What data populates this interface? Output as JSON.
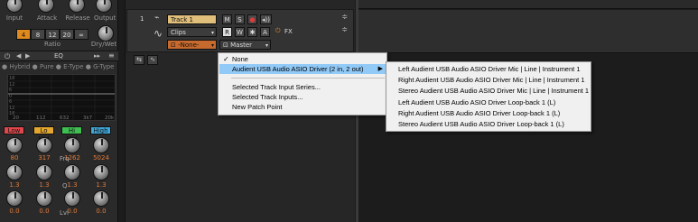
{
  "strip": {
    "knob_labels": [
      "Input",
      "Attack",
      "Release",
      "Output"
    ],
    "ratio_values": [
      "4",
      "8",
      "12",
      "20",
      "∞"
    ],
    "ratio_label": "Ratio",
    "drywet_label": "Dry/Wet",
    "eq_label": "EQ",
    "eq_types": "● Hybrid ● Pure ● E-Type ● G-Type",
    "eq_freq_ticks": [
      "20",
      "112",
      "632",
      "3k7",
      "20k"
    ],
    "eq_gain_ticks": [
      "18",
      "12",
      "6",
      "0",
      "6",
      "12",
      "18"
    ],
    "bands": [
      {
        "label": "Low",
        "color": "#e0474c"
      },
      {
        "label": "Lo Mid",
        "color": "#e3a72f"
      },
      {
        "label": "Hi Mid",
        "color": "#3fbf52"
      },
      {
        "label": "High",
        "color": "#3fa6d8"
      }
    ],
    "freq_values": [
      "80",
      "317",
      "1262",
      "5024"
    ],
    "freq_label": "Frq",
    "q_values": [
      "1.3",
      "1.3",
      "1.3",
      "1.3"
    ],
    "q_label": "Q",
    "gain_values": [
      "0.0",
      "0.0",
      "0.0",
      "0.0"
    ],
    "gain_label": "Lvl"
  },
  "track": {
    "number": "1",
    "name": "Track 1",
    "clips": "Clips",
    "input": "-None-",
    "output": "Master",
    "buttons": [
      "M",
      "S",
      "●",
      "◂))",
      "R",
      "W",
      "✱",
      "A"
    ],
    "fx_label": "FX"
  },
  "menu": {
    "items": [
      {
        "label": "None",
        "checked": true
      },
      {
        "label": "Audient USB Audio ASIO Driver (2 in, 2 out)",
        "submenu": true
      },
      {
        "label": "Selected Track Input Series..."
      },
      {
        "label": "Selected Track Inputs..."
      },
      {
        "label": "New Patch Point"
      }
    ],
    "submenu_items": [
      "Left Audient USB Audio ASIO Driver Mic | Line | Instrument 1",
      "Right Audient USB Audio ASIO Driver Mic | Line | Instrument 1",
      "Stereo Audient USB Audio ASIO Driver Mic | Line | Instrument 1",
      "Left Audient USB Audio ASIO Driver Loop-back 1 (L)",
      "Right Audient USB Audio ASIO Driver Loop-back 1 (L)",
      "Stereo Audient USB Audio ASIO Driver Loop-back 1 (L)"
    ]
  },
  "colors": {
    "ratio_active": "#e08a1e",
    "track_name_bg": "#e0bf7a",
    "input_field_bg": "#c66a2e",
    "menu_highlight": "#91c9f7"
  }
}
